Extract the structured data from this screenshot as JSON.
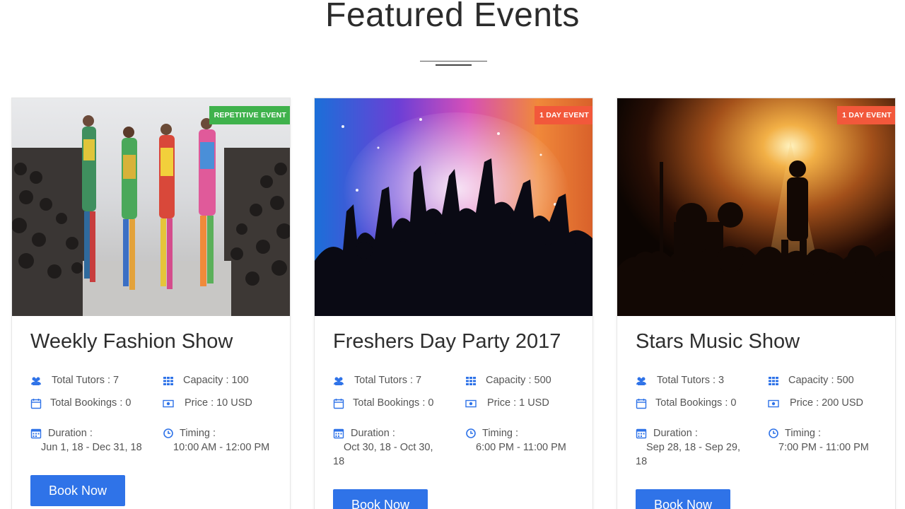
{
  "section": {
    "title": "Featured Events"
  },
  "events": [
    {
      "badge": "REPETITIVE EVENT",
      "title": "Weekly Fashion Show",
      "tutors": "Total Tutors : 7",
      "capacity": "Capacity : 100",
      "bookings": "Total Bookings : 0",
      "price": "Price : 10 USD",
      "duration_label": "Duration :",
      "duration": "Jun 1, 18 - Dec 31, 18",
      "timing_label": "Timing :",
      "timing": "10:00 AM - 12:00 PM",
      "button": "Book Now"
    },
    {
      "badge": "1 DAY EVENT",
      "title": "Freshers Day Party 2017",
      "tutors": "Total Tutors : 7",
      "capacity": "Capacity : 500",
      "bookings": "Total Bookings : 0",
      "price": "Price : 1 USD",
      "duration_label": "Duration :",
      "duration_line1": "Oct 30, 18 - Oct 30,",
      "duration_line2": "18",
      "timing_label": "Timing :",
      "timing": "6:00 PM - 11:00 PM",
      "button": "Book Now"
    },
    {
      "badge": "1 DAY EVENT",
      "title": "Stars Music Show",
      "tutors": "Total Tutors : 3",
      "capacity": "Capacity : 500",
      "bookings": "Total Bookings : 0",
      "price": "Price : 200 USD",
      "duration_label": "Duration :",
      "duration_line1": "Sep 28, 18 - Sep 29,",
      "duration_line2": "18",
      "timing_label": "Timing :",
      "timing": "7:00 PM - 11:00 PM",
      "button": "Book Now"
    }
  ],
  "colors": {
    "accent": "#2f73e8",
    "badge_green": "#3fb24c",
    "badge_orange": "#f2583b"
  }
}
